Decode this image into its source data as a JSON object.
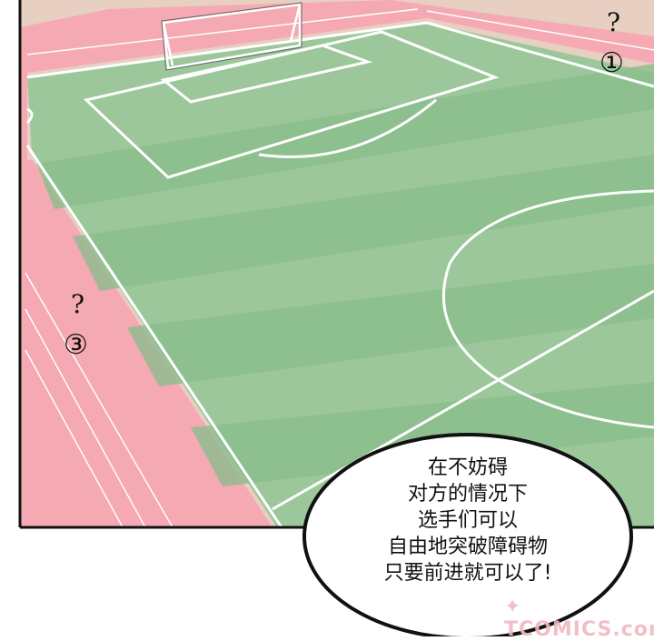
{
  "scene": {
    "colors": {
      "grass_light": "#9cc79a",
      "grass_dark": "#86b988",
      "track": "#f4a9b3",
      "track_lines": "#ffffff",
      "outer_bg": "#e7cfc2",
      "panel_border": "#111111"
    },
    "marks": {
      "top_right_question": "?",
      "top_right_number": "①",
      "left_question": "?",
      "left_number": "③"
    }
  },
  "bubble": {
    "lines": [
      "在不妨碍",
      "对方的情况下",
      "选手们可以",
      "自由地突破障碍物",
      "只要前进就可以了!"
    ]
  },
  "watermark": {
    "text": "TCOMICS.com",
    "icon": "bird-logo-icon"
  }
}
